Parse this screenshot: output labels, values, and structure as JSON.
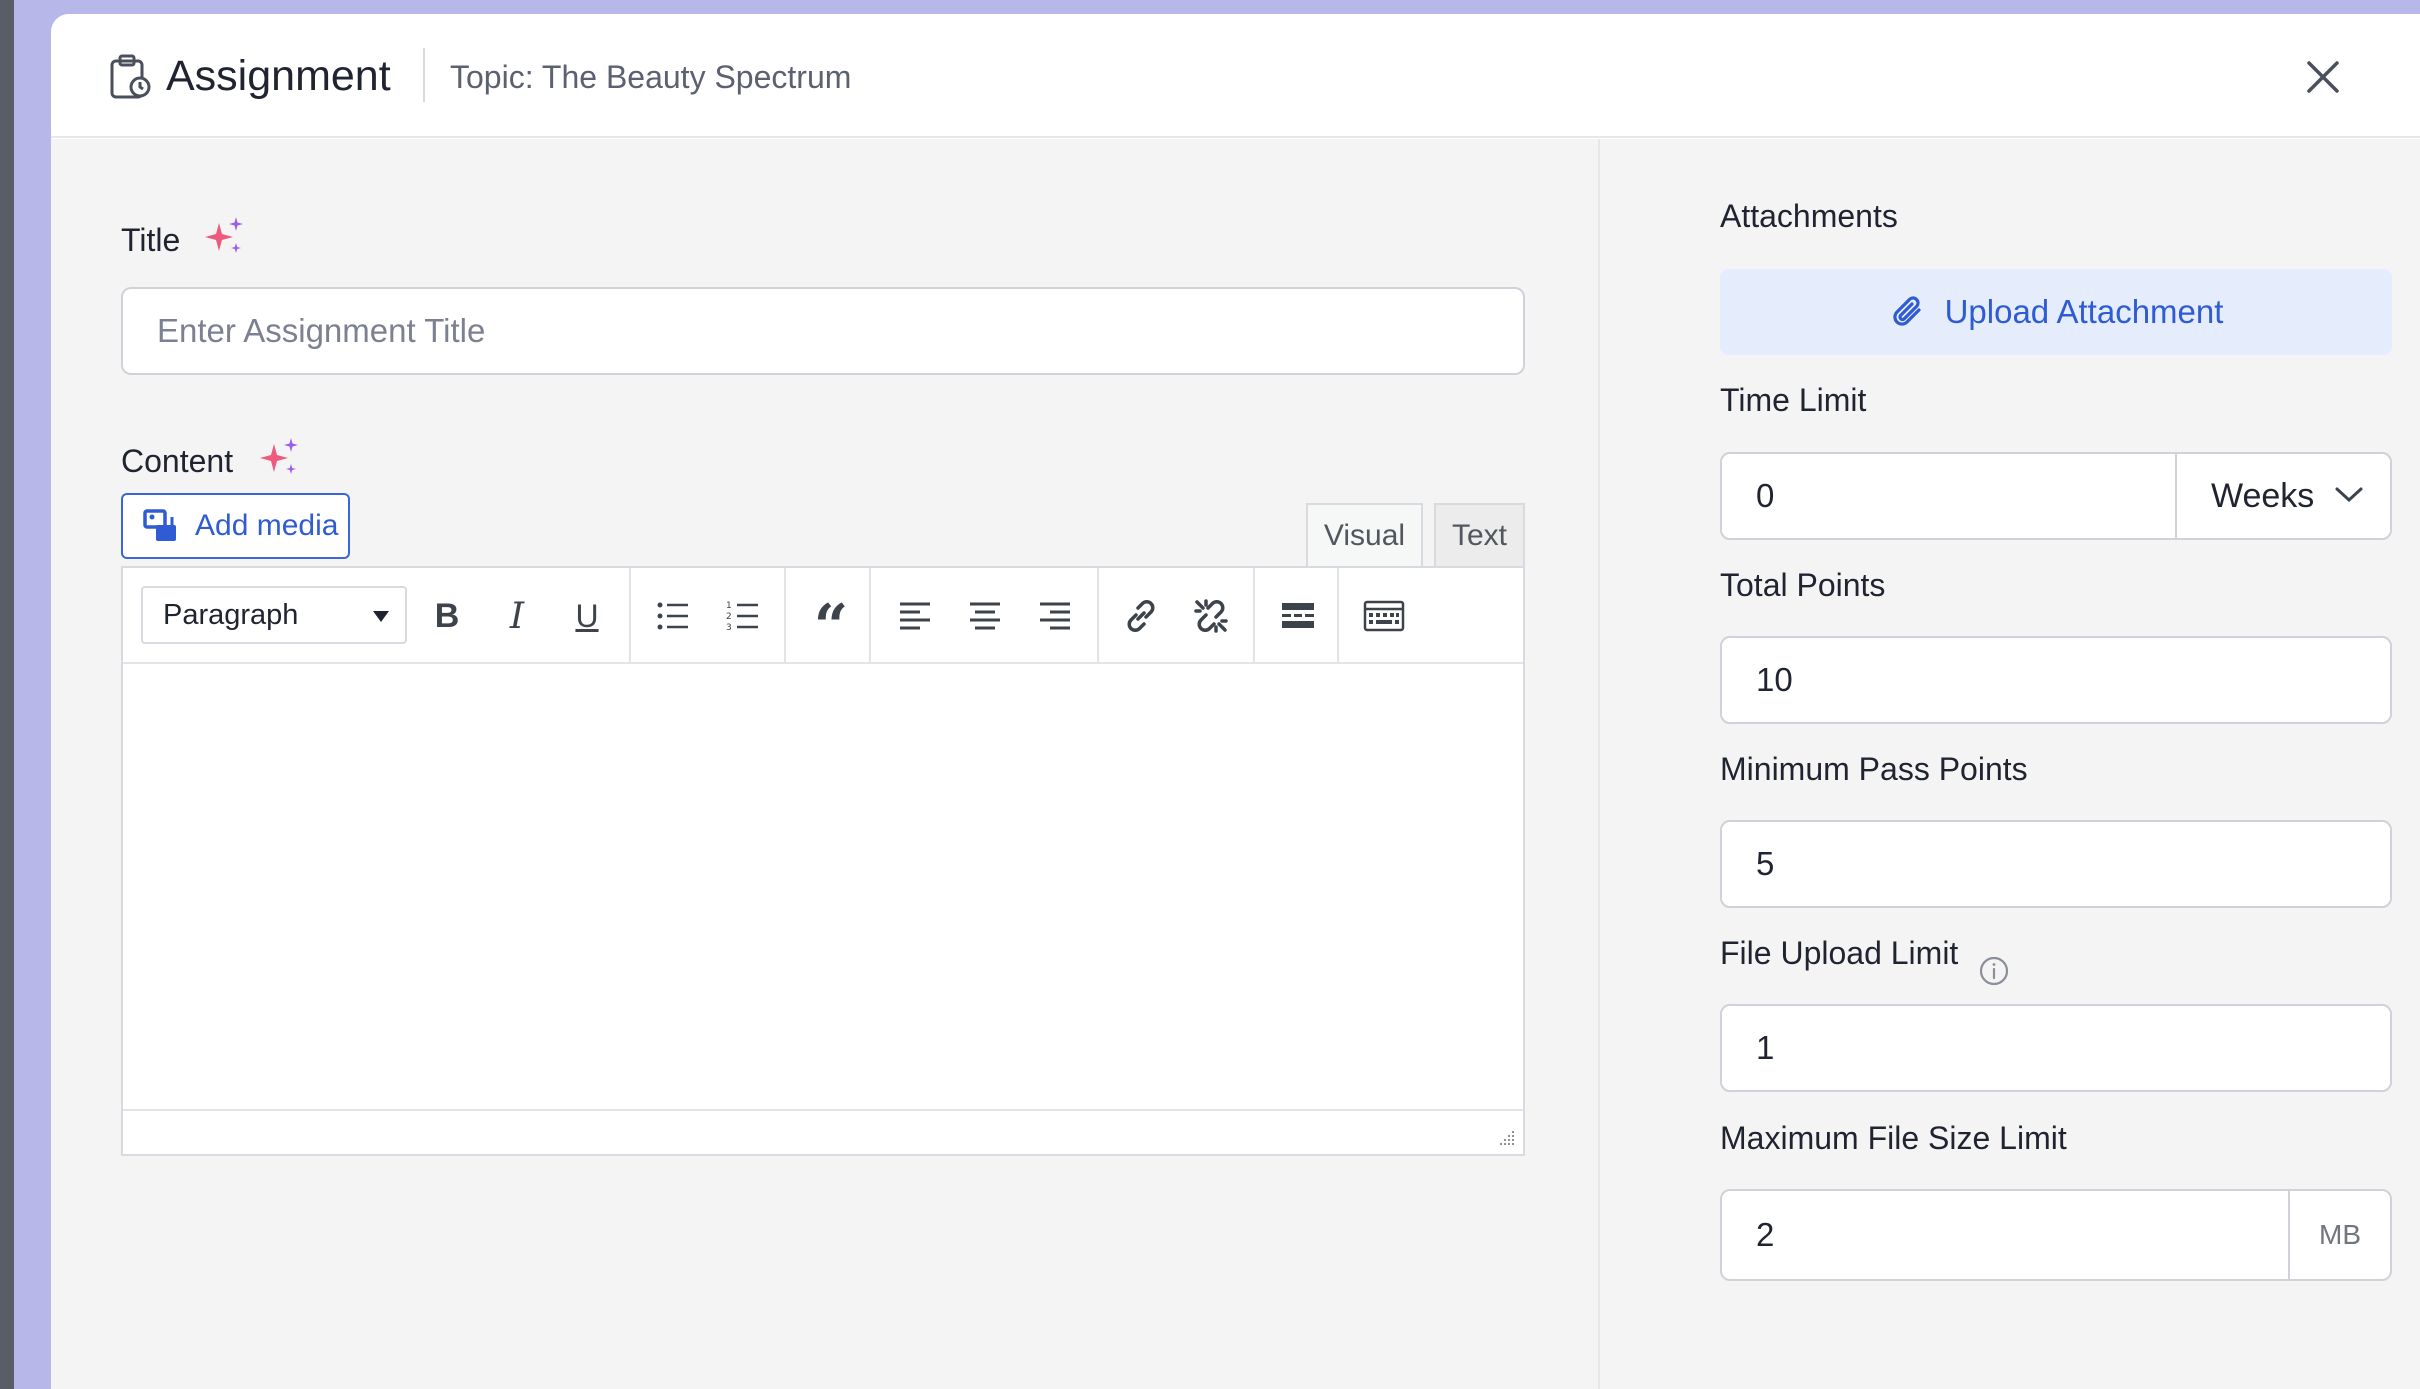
{
  "header": {
    "title": "Assignment",
    "topic": "Topic: The Beauty Spectrum"
  },
  "form": {
    "title_label": "Title",
    "title_placeholder": "Enter Assignment Title",
    "content_label": "Content",
    "add_media_label": "Add media",
    "editor_tabs": [
      "Visual",
      "Text"
    ],
    "format_select": "Paragraph"
  },
  "sidebar": {
    "attachments_label": "Attachments",
    "upload_label": "Upload Attachment",
    "time_limit_label": "Time Limit",
    "time_limit_value": "0",
    "time_limit_unit": "Weeks",
    "total_points_label": "Total Points",
    "total_points_value": "10",
    "min_pass_label": "Minimum Pass Points",
    "min_pass_value": "5",
    "file_upload_limit_label": "File Upload Limit",
    "file_upload_limit_value": "1",
    "max_file_size_label": "Maximum File Size Limit",
    "max_file_size_value": "2",
    "max_file_size_unit": "MB"
  },
  "colors": {
    "accent": "#2f5bd3",
    "upload_bg": "#e5ecfb",
    "sparkle_pink": "#ee5a7e",
    "sparkle_purple": "#9b5cf0"
  }
}
